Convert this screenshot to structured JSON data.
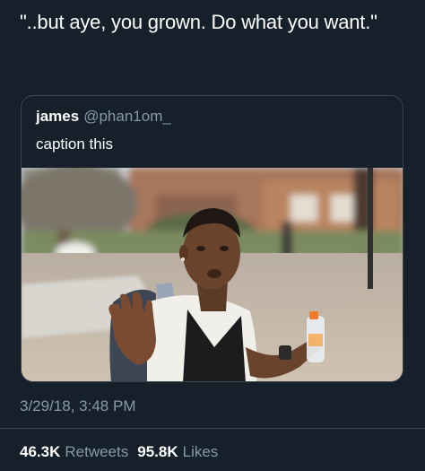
{
  "tweet": {
    "text": "\"..but aye, you grown. Do what you want.\""
  },
  "quoted_tweet": {
    "name": "james",
    "handle": "@phan1om_",
    "text": "caption this"
  },
  "timestamp": "3/29/18, 3:48 PM",
  "stats": {
    "retweets_count": "46.3K",
    "retweets_label": "Retweets",
    "likes_count": "95.8K",
    "likes_label": "Likes"
  },
  "colors": {
    "background": "#15202b",
    "secondary_text": "#8899a6",
    "border": "#38444d"
  }
}
